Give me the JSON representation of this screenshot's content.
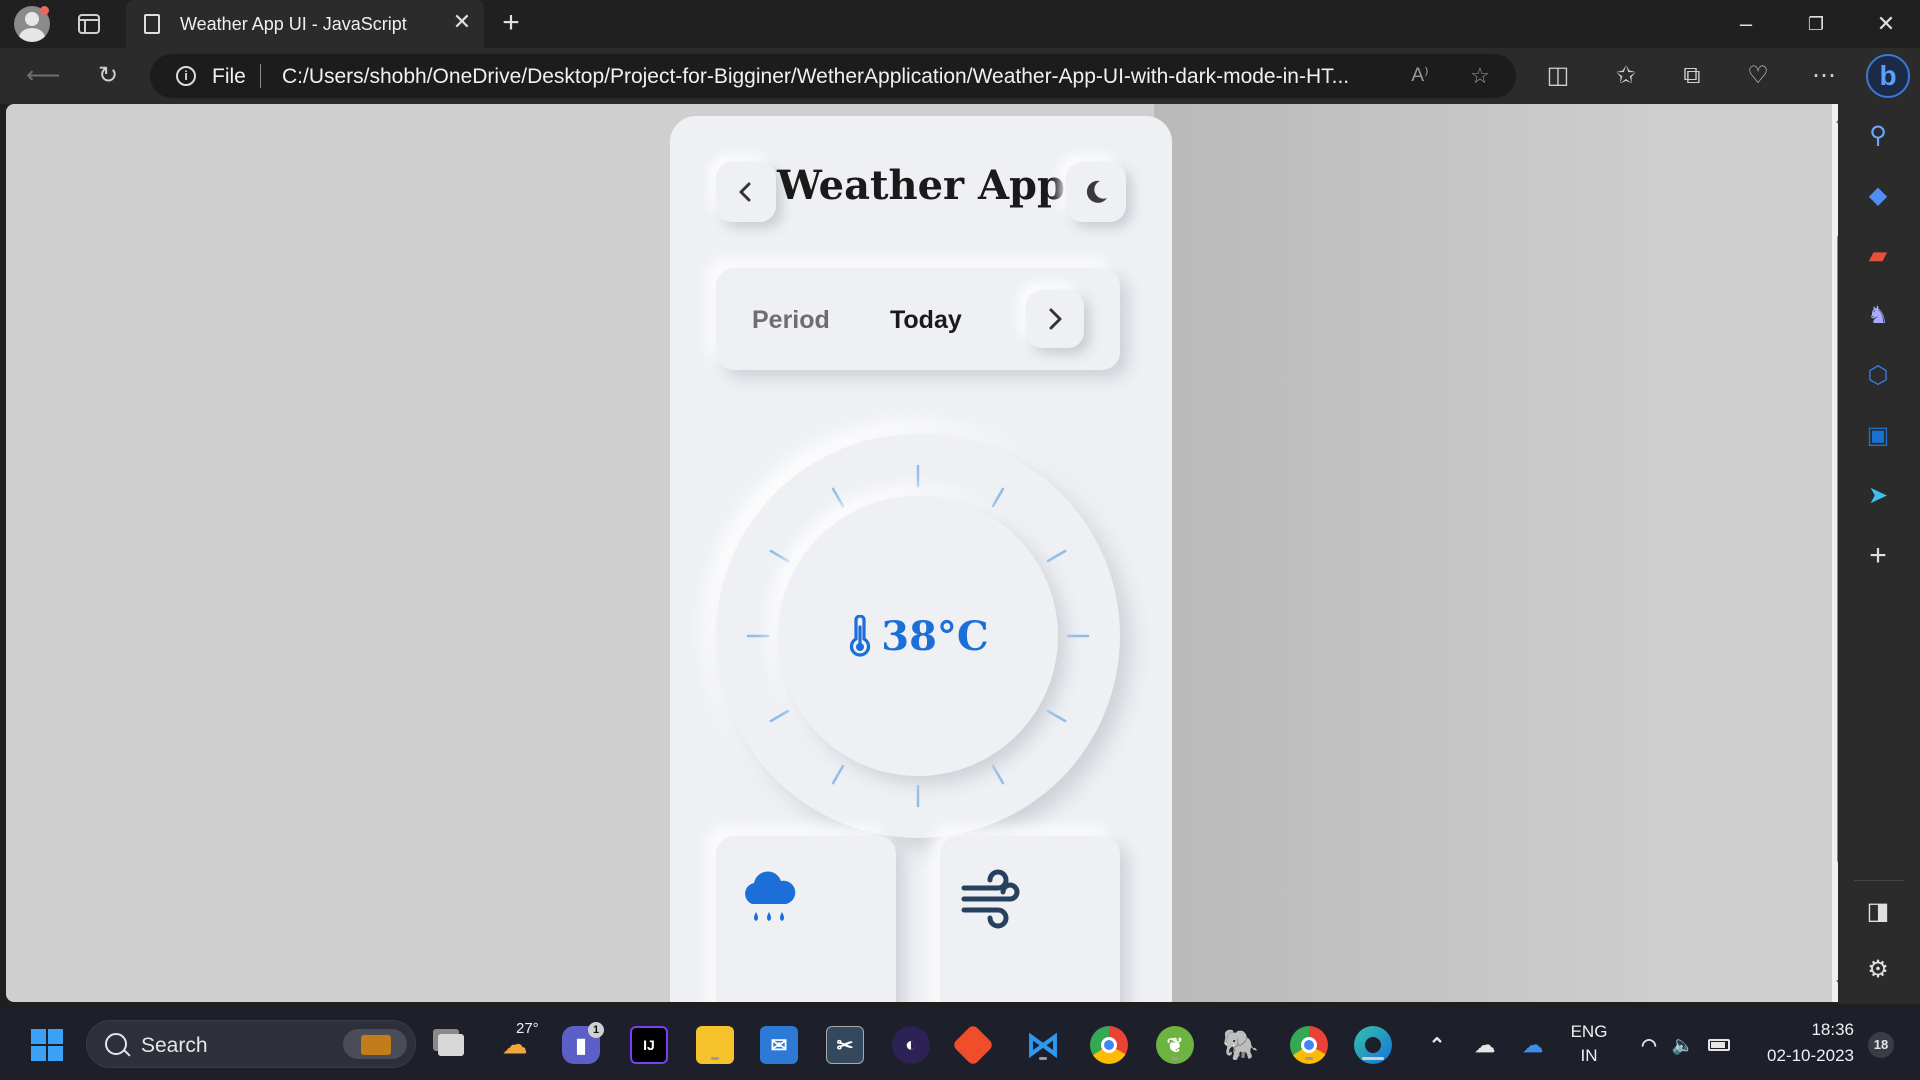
{
  "browser": {
    "tab_title": "Weather App UI - JavaScript",
    "address_prefix": "File",
    "url": "C:/Users/shobh/OneDrive/Desktop/Project-for-Bigginer/WetherApplication/Weather-App-UI-with-dark-mode-in-HT...",
    "read_aloud_label": "A⁾"
  },
  "app": {
    "title": "Weather App",
    "period_label": "Period",
    "period_value": "Today",
    "temperature": "38°C",
    "accent_color": "#1d6fd8",
    "tick_color": "#8fbcec"
  },
  "taskbar": {
    "search_placeholder": "Search",
    "weather_temp": "27°",
    "teams_badge": "1",
    "language_top": "ENG",
    "language_bottom": "IN",
    "time": "18:36",
    "date": "02-10-2023",
    "notification_count": "18",
    "intellij_label": "IJ"
  }
}
